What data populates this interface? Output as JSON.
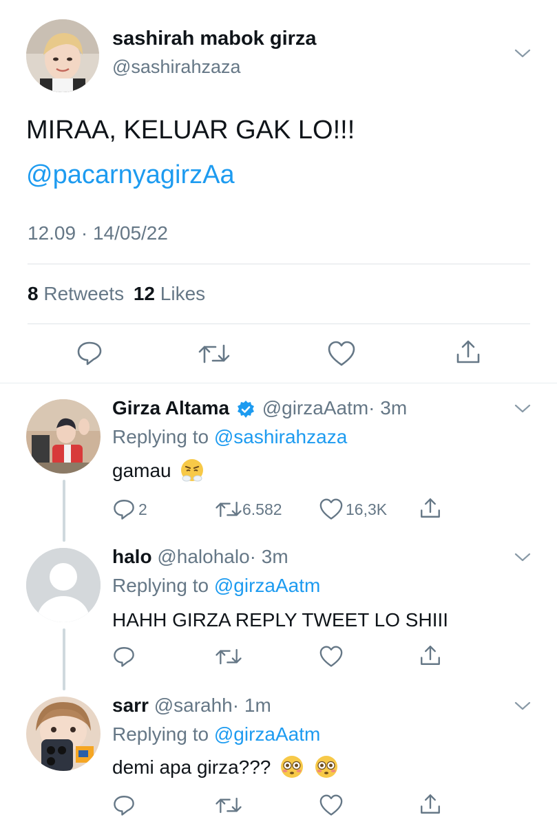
{
  "main_tweet": {
    "display_name": "sashirah mabok girza",
    "handle": "@sashirahzaza",
    "text": "MIRAA, KELUAR GAK LO!!!",
    "mention": "@pacarnyagirzAa",
    "timestamp": "12.09 · 14/05/22",
    "retweets_count": "8",
    "retweets_label": "Retweets",
    "likes_count": "12",
    "likes_label": "Likes"
  },
  "replies": [
    {
      "display_name": "Girza Altama",
      "verified": true,
      "handle": "@girzaAatm",
      "time": "· 3m",
      "replying_label": "Replying to",
      "replying_to": "@sashirahzaza",
      "text": "gamau",
      "emoji": "face-with-steam-from-nose",
      "reply_count": "2",
      "retweet_count": "6.582",
      "like_count": "16,3K"
    },
    {
      "display_name": "halo",
      "verified": false,
      "handle": "@halohalo",
      "time": "· 3m",
      "replying_label": "Replying to",
      "replying_to": "@girzaAatm",
      "text": "HAHH GIRZA REPLY TWEET LO SHIII",
      "reply_count": "",
      "retweet_count": "",
      "like_count": ""
    },
    {
      "display_name": "sarr",
      "verified": false,
      "handle": "@sarahh",
      "time": "· 1m",
      "replying_label": "Replying to",
      "replying_to": "@girzaAatm",
      "text": "demi apa girza???",
      "emoji": "flushed-face",
      "reply_count": "",
      "retweet_count": "",
      "like_count": ""
    }
  ],
  "colors": {
    "link_blue": "#1d9bf0",
    "secondary_grey": "#657786",
    "divider": "#dfe3e7",
    "thread_line": "#cfd9de"
  }
}
